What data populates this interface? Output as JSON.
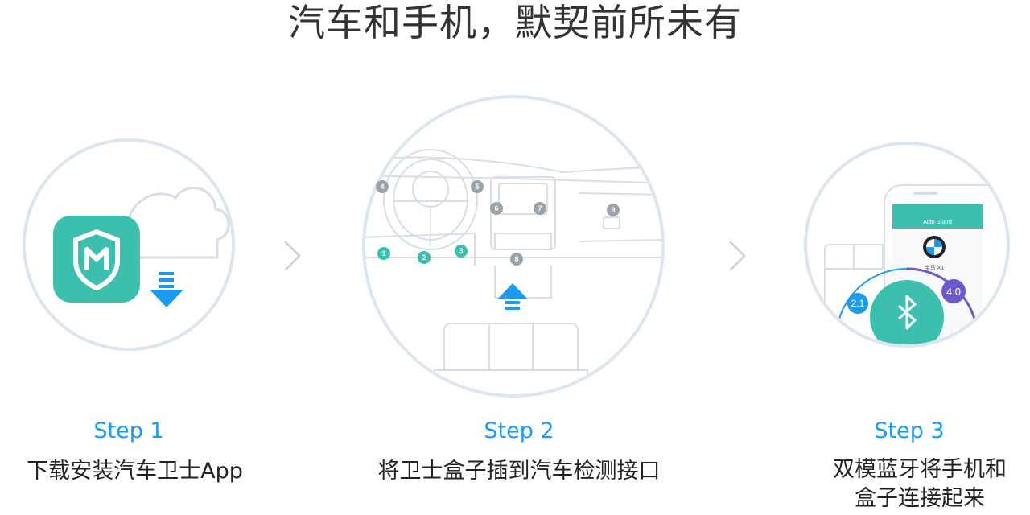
{
  "headline": "汽车和手机，默契前所未有",
  "steps": [
    {
      "label": "Step 1",
      "desc": "下载安装汽车卫士App"
    },
    {
      "label": "Step 2",
      "desc": "将卫士盒子插到汽车检测接口"
    },
    {
      "label": "Step 3",
      "desc_line1": "双模蓝牙将手机和",
      "desc_line2": "盒子连接起来"
    }
  ],
  "dashboard_markers": {
    "teal": [
      "1",
      "2",
      "3"
    ],
    "gray": [
      "4",
      "5",
      "6",
      "7",
      "8",
      "9"
    ]
  },
  "phone": {
    "app_title": "Auto Guard",
    "car_name": "宝马 X1"
  },
  "bluetooth_versions": {
    "left": "2.1",
    "right": "4.0"
  },
  "colors": {
    "accent_blue": "#1a9bf0",
    "teal": "#3dbfad",
    "bt_purple": "#6a5acd"
  },
  "icons": {
    "app": "shield-m-icon",
    "download": "download-arrow-icon",
    "upload": "insert-arrow-icon",
    "bluetooth": "bluetooth-icon",
    "next": "chevron-right-icon"
  }
}
